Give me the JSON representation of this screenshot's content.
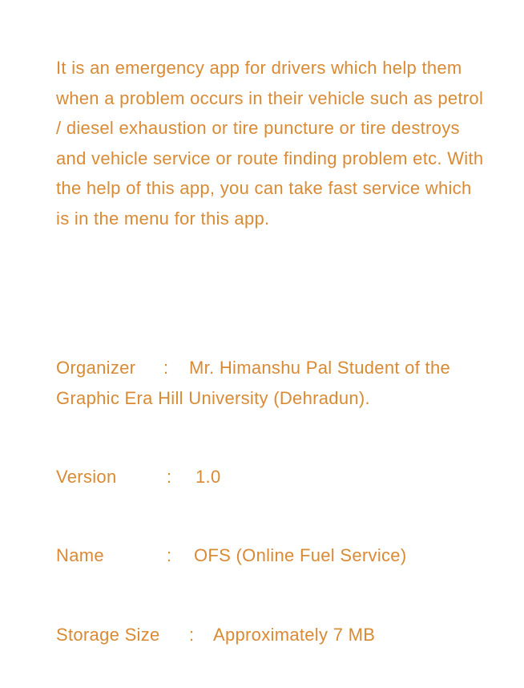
{
  "description": "It is an emergency app for drivers which help them when a problem occurs in their vehicle such as petrol / diesel exhaustion or tire puncture or tire destroys and vehicle service or route finding problem etc. With the help of this app, you can take fast service which is in the menu for this app.",
  "info": {
    "organizer": {
      "label": "Organizer",
      "separator": ":",
      "value": "Mr. Himanshu Pal Student of the Graphic Era Hill University (Dehradun)."
    },
    "version": {
      "label": "Version",
      "separator": ":",
      "value": "1.0"
    },
    "name": {
      "label": "Name",
      "separator": ":",
      "value": "OFS (Online Fuel Service)"
    },
    "storage": {
      "label": "Storage Size",
      "separator": ":",
      "value": "Approximately 7 MB"
    }
  },
  "colors": {
    "text": "#d98a34",
    "background": "#ffffff"
  }
}
